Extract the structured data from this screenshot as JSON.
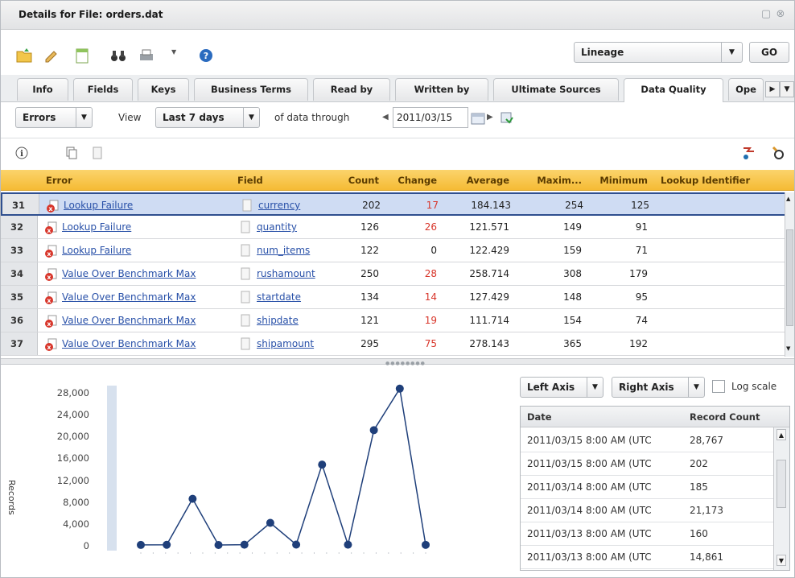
{
  "window": {
    "title": "Details for File: orders.dat"
  },
  "toolbar": {
    "icons": [
      "folder-icon",
      "edit-icon",
      "notes-icon",
      "binoculars-icon",
      "print-icon",
      "help-icon"
    ],
    "lineage_label": "Lineage",
    "go_label": "GO"
  },
  "tabs": [
    {
      "label": "Info"
    },
    {
      "label": "Fields"
    },
    {
      "label": "Keys"
    },
    {
      "label": "Business Terms"
    },
    {
      "label": "Read by"
    },
    {
      "label": "Written by"
    },
    {
      "label": "Ultimate Sources"
    },
    {
      "label": "Data Quality"
    },
    {
      "label": "Ope"
    }
  ],
  "active_tab": "Data Quality",
  "filter": {
    "type_label": "Errors",
    "view_label": "View",
    "range_label": "Last 7 days",
    "through_label": "of data through",
    "date_value": "2011/03/15"
  },
  "grid": {
    "columns": [
      "Error",
      "Field",
      "Count",
      "Change",
      "Average",
      "Maxim...",
      "Minimum",
      "Lookup Identifier"
    ],
    "rows": [
      {
        "num": "31",
        "error": "Lookup Failure",
        "field": "currency",
        "count": "202",
        "change": "17",
        "average": "184.143",
        "max": "254",
        "min": "125",
        "lookup": "",
        "selected": true
      },
      {
        "num": "32",
        "error": "Lookup Failure",
        "field": "quantity",
        "count": "126",
        "change": "26",
        "average": "121.571",
        "max": "149",
        "min": "91",
        "lookup": ""
      },
      {
        "num": "33",
        "error": "Lookup Failure",
        "field": "num_items",
        "count": "122",
        "change": "0",
        "average": "122.429",
        "max": "159",
        "min": "71",
        "lookup": ""
      },
      {
        "num": "34",
        "error": "Value Over Benchmark Max",
        "field": "rushamount",
        "count": "250",
        "change": "28",
        "average": "258.714",
        "max": "308",
        "min": "179",
        "lookup": ""
      },
      {
        "num": "35",
        "error": "Value Over Benchmark Max",
        "field": "startdate",
        "count": "134",
        "change": "14",
        "average": "127.429",
        "max": "148",
        "min": "95",
        "lookup": ""
      },
      {
        "num": "36",
        "error": "Value Over Benchmark Max",
        "field": "shipdate",
        "count": "121",
        "change": "19",
        "average": "111.714",
        "max": "154",
        "min": "74",
        "lookup": ""
      },
      {
        "num": "37",
        "error": "Value Over Benchmark Max",
        "field": "shipamount",
        "count": "295",
        "change": "75",
        "average": "278.143",
        "max": "365",
        "min": "192",
        "lookup": ""
      }
    ]
  },
  "chart_data": {
    "type": "line",
    "ylabel": "Records",
    "y_ticks": [
      "28,000",
      "24,000",
      "20,000",
      "16,000",
      "12,000",
      "8,000",
      "4,000",
      "0"
    ],
    "ylim": [
      0,
      28000
    ],
    "values": [
      160,
      185,
      8600,
      150,
      200,
      4200,
      220,
      14861,
      202,
      21173,
      28767,
      170
    ],
    "series_color": "#1f3f7a"
  },
  "axis_controls": {
    "left_axis_label": "Left Axis",
    "right_axis_label": "Right Axis",
    "log_scale_label": "Log scale"
  },
  "data_table": {
    "columns": [
      "Date",
      "Record Count"
    ],
    "rows": [
      {
        "date": "2011/03/15 8:00 AM (UTC",
        "count": "28,767"
      },
      {
        "date": "2011/03/15 8:00 AM (UTC",
        "count": "202"
      },
      {
        "date": "2011/03/14 8:00 AM (UTC",
        "count": "185"
      },
      {
        "date": "2011/03/14 8:00 AM (UTC",
        "count": "21,173"
      },
      {
        "date": "2011/03/13 8:00 AM (UTC",
        "count": "160"
      },
      {
        "date": "2011/03/13 8:00 AM (UTC",
        "count": "14,861"
      }
    ]
  },
  "colors": {
    "header_accent": "#f5bb34",
    "selection": "#cfdcf3",
    "link": "#2850a8",
    "change_red": "#d8362b"
  }
}
